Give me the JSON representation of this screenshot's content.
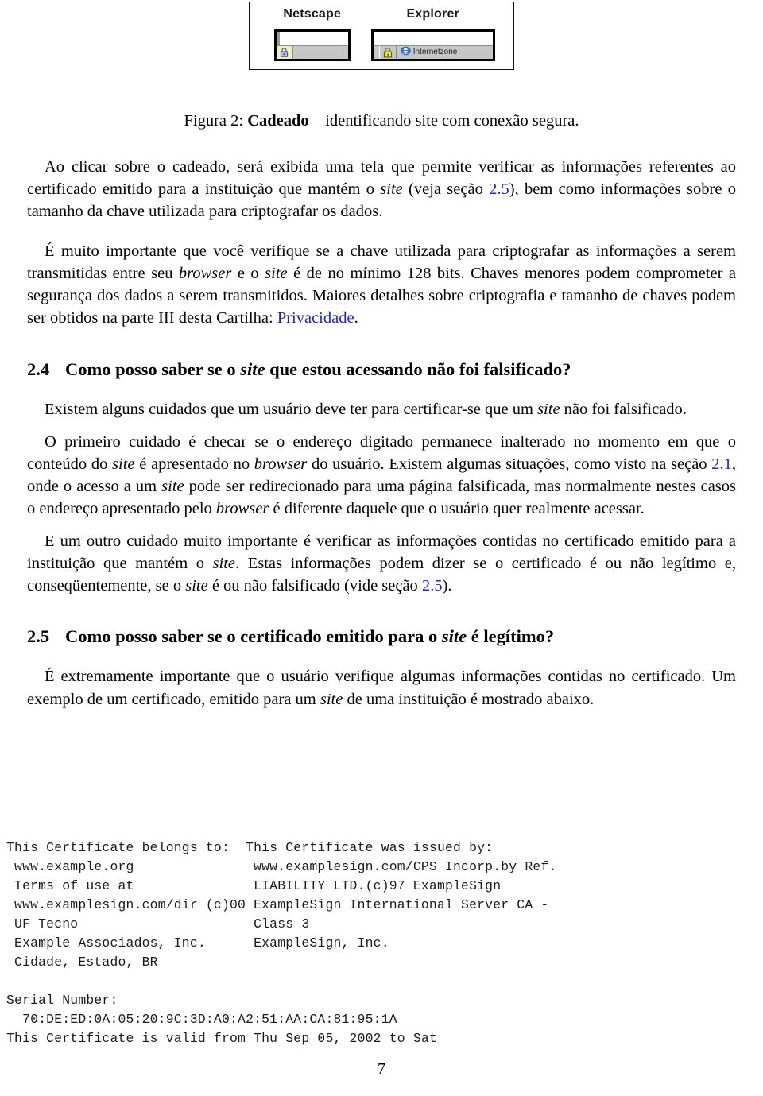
{
  "figure": {
    "netscape": {
      "label": "Netscape",
      "lock_icon": "padlock-icon"
    },
    "explorer": {
      "label": "Explorer",
      "lock_icon": "padlock-icon",
      "ie_icon": "internet-explorer-icon",
      "zone_text": "Internetzone"
    },
    "caption_prefix": "Figura 2: ",
    "caption_bold": "Cadeado",
    "caption_rest": " – identificando site com conexão segura."
  },
  "paragraphs": {
    "p1_a": "Ao clicar sobre o cadeado, será exibida uma tela que permite verificar as informações referentes ao certificado emitido para a instituição que mantém o ",
    "p1_site": "site",
    "p1_b": " (veja seção ",
    "p1_link": "2.5",
    "p1_c": "), bem como informações sobre o tamanho da chave utilizada para criptografar os dados.",
    "p2_a": "É muito importante que você verifique se a chave utilizada para criptografar as informações a serem transmitidas entre seu ",
    "p2_browser": "browser",
    "p2_b": " e o ",
    "p2_site": "site",
    "p2_c": " é de no mínimo 128 bits. Chaves menores podem comprometer a segurança dos dados a serem transmitidos. Maiores detalhes sobre criptografia e tamanho de chaves podem ser obtidos na parte III desta Cartilha: ",
    "p2_link": "Privacidade",
    "p2_d": ".",
    "p3_a": "Existem alguns cuidados que um usuário deve ter para certificar-se que um ",
    "p3_site": "site",
    "p3_b": " não foi falsificado.",
    "p4_a": "O primeiro cuidado é checar se o endereço digitado permanece inalterado no momento em que o conteúdo do ",
    "p4_site1": "site",
    "p4_b": " é apresentado no ",
    "p4_browser1": "browser",
    "p4_c": " do usuário. Existem algumas situações, como visto na seção ",
    "p4_link": "2.1",
    "p4_d": ", onde o acesso a um ",
    "p4_site2": "site",
    "p4_e": " pode ser redirecionado para uma página falsificada, mas normalmente nestes casos o endereço apresentado pelo ",
    "p4_browser2": "browser",
    "p4_f": " é diferente daquele que o usuário quer realmente acessar.",
    "p5_a": "E um outro cuidado muito importante é verificar as informações contidas no certificado emitido para a instituição que mantém o ",
    "p5_site1": "site",
    "p5_b": ". Estas informações podem dizer se o certificado é ou não legítimo e, conseqüentemente, se o ",
    "p5_site2": "site",
    "p5_c": " é ou não falsificado (vide seção ",
    "p5_link": "2.5",
    "p5_d": ").",
    "p6_a": "É extremamente importante que o usuário verifique algumas informações contidas no certificado. Um exemplo de um certificado, emitido para um ",
    "p6_site": "site",
    "p6_b": " de uma instituição é mostrado abaixo."
  },
  "sections": {
    "s24_num": "2.4",
    "s24_title_a": "Como posso saber se o ",
    "s24_title_site": "site",
    "s24_title_b": " que estou acessando não foi falsificado?",
    "s25_num": "2.5",
    "s25_title_a": "Como posso saber se o certificado emitido para o ",
    "s25_title_site": "site",
    "s25_title_b": " é legítimo?"
  },
  "certificate": {
    "text": "This Certificate belongs to:  This Certificate was issued by:\n www.example.org               www.examplesign.com/CPS Incorp.by Ref.\n Terms of use at               LIABILITY LTD.(c)97 ExampleSign\n www.examplesign.com/dir (c)00 ExampleSign International Server CA -\n UF Tecno                      Class 3\n Example Associados, Inc.      ExampleSign, Inc.\n Cidade, Estado, BR",
    "serial_label": "Serial Number:",
    "serial_value": "  70:DE:ED:0A:05:20:9C:3D:A0:A2:51:AA:CA:81:95:1A",
    "validity": "This Certificate is valid from Thu Sep 05, 2002 to Sat"
  },
  "footer": {
    "page_number": "7"
  },
  "colors": {
    "link": "#2222cc",
    "text": "#000000",
    "chrome_gray": "#c6c6c6"
  }
}
